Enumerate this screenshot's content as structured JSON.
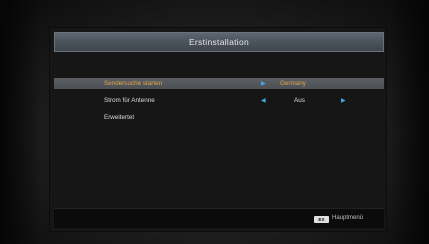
{
  "header": {
    "title": "Erstinstallation"
  },
  "menu": {
    "items": [
      {
        "label": "Sendersuche starten",
        "value": "Germany",
        "selected": true
      },
      {
        "label": "Strom für Antenne",
        "value": "Aus",
        "selected": false
      },
      {
        "label": "Erweitertet",
        "value": "",
        "selected": false
      }
    ]
  },
  "arrows": {
    "left": "◀",
    "right": "▶"
  },
  "footer": {
    "exit_key": "EX",
    "exit_label": "Hauptmenü"
  },
  "colors": {
    "selected_text": "#e4a349",
    "arrow": "#3ab0e8",
    "header_bg": "#4b535b",
    "panel_bg": "#161616"
  }
}
